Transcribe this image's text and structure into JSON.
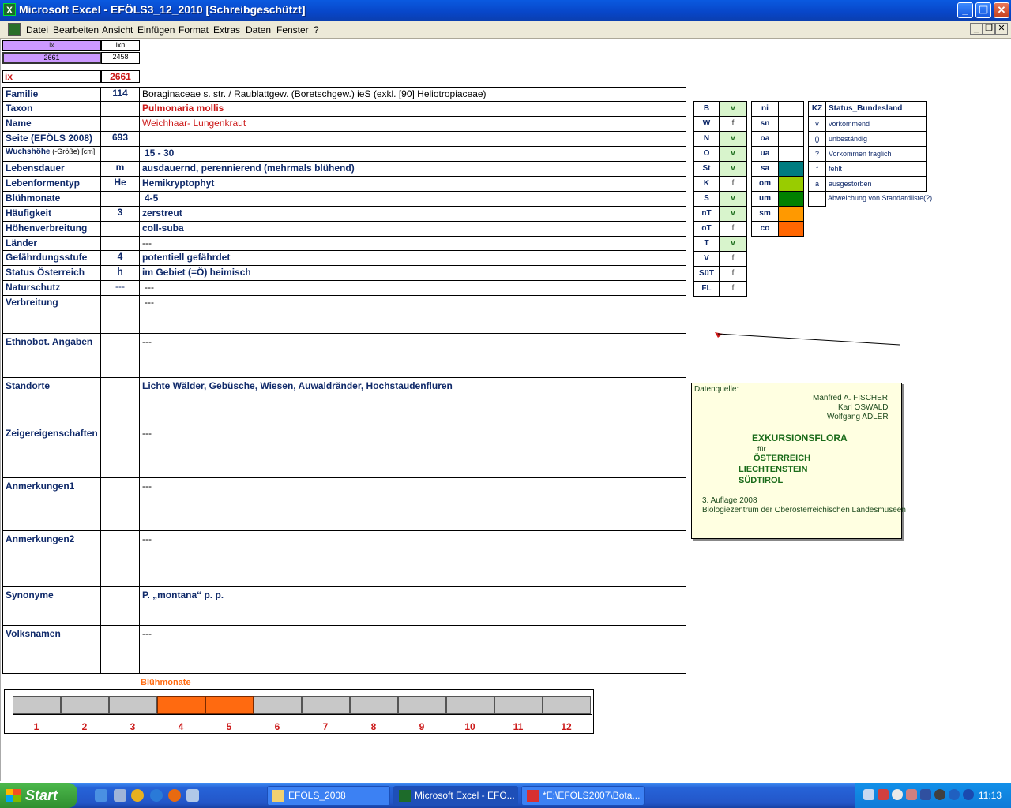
{
  "window": {
    "title": "Microsoft Excel - EFÖLS3_12_2010  [Schreibgeschützt]"
  },
  "menu": [
    "Datei",
    "Bearbeiten",
    "Ansicht",
    "Einfügen",
    "Format",
    "Extras",
    "Daten",
    "Fenster",
    "?"
  ],
  "top": {
    "ix_head": "ix",
    "ixn_head": "ixn",
    "ix_val": "2661",
    "ixn_val": "2458",
    "ix_label": "ix",
    "ix_value": "2661"
  },
  "fields": [
    {
      "label": "Familie",
      "code": "114",
      "value": "Boraginaceae s. str.  /  Raublattgew. (Boretschgew.) ieS (exkl. [90] Heliotropiaceae)"
    },
    {
      "label": "Taxon",
      "code": "",
      "value": "Pulmonaria mollis"
    },
    {
      "label": "Name",
      "code": "",
      "value": "Weichhaar- Lungenkraut"
    },
    {
      "label": "Seite (EFÖLS 2008)",
      "code": "693",
      "value": ""
    },
    {
      "label": "Wuchshöhe",
      "label_suffix": "(-Größe) [cm]",
      "code": "",
      "value": "15 - 30"
    },
    {
      "label": "Lebensdauer",
      "code": "m",
      "value": "ausdauernd, perennierend (mehrmals blühend)"
    },
    {
      "label": "Lebenformentyp",
      "code": "He",
      "value": "Hemikryptophyt"
    },
    {
      "label": "Blühmonate",
      "code": "",
      "value": "4-5"
    },
    {
      "label": "Häufigkeit",
      "code": "3",
      "value": "zerstreut"
    },
    {
      "label": "Höhenverbreitung",
      "code": "",
      "value": "coll-suba"
    },
    {
      "label": "Länder",
      "code": "",
      "value": "---"
    },
    {
      "label": "Gefährdungsstufe",
      "code": "4",
      "value": "potentiell gefährdet"
    },
    {
      "label": "Status Österreich",
      "code": "h",
      "value": "im Gebiet (=Ö) heimisch"
    },
    {
      "label": "Naturschutz",
      "code": "---",
      "value": "---"
    },
    {
      "label": "Verbreitung",
      "code": "",
      "value": "---"
    },
    {
      "label": "Ethnobot. Angaben",
      "code": "",
      "value": "---"
    },
    {
      "label": "Standorte",
      "code": "",
      "value": "Lichte Wälder, Gebüsche, Wiesen, Auwaldränder, Hochstaudenfluren"
    },
    {
      "label": "Zeigereigenschaften",
      "code": "",
      "value": "---"
    },
    {
      "label": "Anmerkungen1",
      "code": "",
      "value": "---"
    },
    {
      "label": "Anmerkungen2",
      "code": "",
      "value": "---"
    },
    {
      "label": "Synonyme",
      "code": "",
      "value": "P. „montana“ p. p."
    },
    {
      "label": "Volksnamen",
      "code": "",
      "value": "---"
    }
  ],
  "regions": [
    {
      "code": "B",
      "status": "v"
    },
    {
      "code": "W",
      "status": "f"
    },
    {
      "code": "N",
      "status": "v"
    },
    {
      "code": "O",
      "status": "v"
    },
    {
      "code": "St",
      "status": "v"
    },
    {
      "code": "K",
      "status": "f"
    },
    {
      "code": "S",
      "status": "v"
    },
    {
      "code": "nT",
      "status": "v"
    },
    {
      "code": "oT",
      "status": "f"
    },
    {
      "code": "T",
      "status": "v"
    },
    {
      "code": "V",
      "status": "f"
    },
    {
      "code": "SüT",
      "status": "f"
    },
    {
      "code": "FL",
      "status": "f"
    }
  ],
  "zones": [
    {
      "code": "ni",
      "color": ""
    },
    {
      "code": "sn",
      "color": ""
    },
    {
      "code": "oa",
      "color": ""
    },
    {
      "code": "ua",
      "color": ""
    },
    {
      "code": "sa",
      "color": "#007c80"
    },
    {
      "code": "om",
      "color": "#99cc00"
    },
    {
      "code": "um",
      "color": "#008000"
    },
    {
      "code": "sm",
      "color": "#ff9900"
    },
    {
      "code": "co",
      "color": "#ff6600"
    }
  ],
  "legend": {
    "head_kz": "KZ",
    "head_status": "Status_Bundesland",
    "items": [
      {
        "k": "v",
        "t": "vorkommend"
      },
      {
        "k": "()",
        "t": "unbeständig"
      },
      {
        "k": "?",
        "t": "Vorkommen fraglich"
      },
      {
        "k": "f",
        "t": "fehlt"
      },
      {
        "k": "a",
        "t": "ausgestorben"
      },
      {
        "k": "!",
        "t": "Abweichung von Standardliste(?)"
      }
    ]
  },
  "note": {
    "l1": "Datenquelle:",
    "a1": "Manfred A. FISCHER",
    "a2": "Karl OSWALD",
    "a3": "Wolfgang ADLER",
    "t1": "EXKURSIONSFLORA",
    "t2": "für",
    "t3": "ÖSTERREICH",
    "t4": "LIECHTENSTEIN",
    "t5": "SÜDTIROL",
    "e1": "3. Auflage 2008",
    "e2": "Biologiezentrum der Oberösterreichischen Landesmuseen"
  },
  "chart_data": {
    "type": "bar",
    "title": "Blühmonate",
    "categories": [
      "1",
      "2",
      "3",
      "4",
      "5",
      "6",
      "7",
      "8",
      "9",
      "10",
      "11",
      "12"
    ],
    "values": [
      0,
      0,
      0,
      1,
      1,
      0,
      0,
      0,
      0,
      0,
      0,
      0
    ],
    "colors": {
      "on": "#ff6a10",
      "off": "#c8c8c8"
    }
  },
  "taskbar": {
    "start": "Start",
    "tasks": [
      "EFÖLS_2008",
      "Microsoft Excel - EFÖ...",
      "*E:\\EFÖLS2007\\Bota..."
    ],
    "clock": "11:13"
  }
}
